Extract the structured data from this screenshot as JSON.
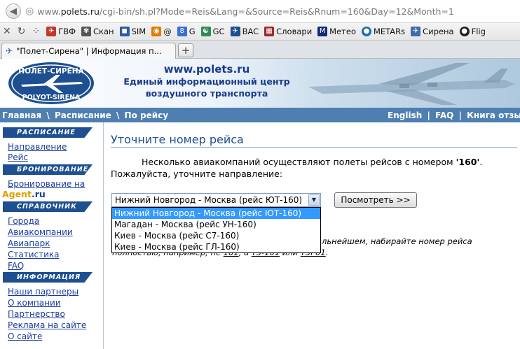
{
  "browser": {
    "url_scheme": "www.",
    "url_host": "polets.ru",
    "url_path": "/cgi-bin/sh.pl?Mode=Reis&Lang=&Source=Reis&Rnum=160&Day=12&Month=1",
    "bookmarks": [
      "ГВФ",
      "Скан",
      "SIM",
      "@",
      "G",
      "GC",
      "BAC",
      "Словари",
      "Метео",
      "METARs",
      "Сирена",
      "Flig"
    ],
    "tab_title": "\"Полет-Сирена\" | Информация п...",
    "new_tab": "+"
  },
  "header": {
    "logo_top": "ПОЛЕТ-СИРЕНА",
    "logo_bottom": "POLYOT-SIRENA",
    "site": "www.polets.ru",
    "line1": "Единый информационный центр",
    "line2": "воздушного транспорта"
  },
  "navbar": {
    "crumb1": "Главная",
    "crumb2": "Расписание",
    "crumb3": "По рейсу",
    "sep": "\\",
    "right1": "English",
    "right2": "FAQ",
    "right3": "Книга отзывов",
    "pipe": "|"
  },
  "sidebar": {
    "schedule_head": "РАСПИСАНИЕ",
    "direction": "Направление",
    "flight": "Рейс",
    "booking_head": "БРОНИРОВАНИЕ",
    "booking_link": "Бронирование на",
    "agent1": "Agent",
    "agent2": ".ru",
    "reference_head": "СПРАВОЧНИК",
    "cities": "Города",
    "airlines": "Авиакомпании",
    "fleet": "Авиапарк",
    "stats": "Статистика",
    "faq": "FAQ",
    "info_head": "ИНФОРМАЦИЯ",
    "partners": "Наши партнеры",
    "about": "О компании",
    "partnership": "Партнерство",
    "ads": "Реклама на сайте",
    "about_site": "О сайте"
  },
  "main": {
    "title": "Уточните номер рейса",
    "msg1_pre": "Несколько авиакомпаний осуществляют полеты рейсов с номером ",
    "msg1_num": "'160'",
    "msg1_post": ".",
    "msg2": "Пожалуйста, уточните направление:",
    "select_value": "Нижний Новгород - Москва (рейс ЮТ-160)",
    "options": [
      "Нижний Новгород - Москва (рейс ЮТ-160)",
      "Магадан - Москва (рейс УН-160)",
      "Киев - Москва (рейс С7-160)",
      "Киев - Москва (рейс ГЛ-160)"
    ],
    "view_button": "Посмотреть >>",
    "hint1": "альнейшем, набирайте номер рейса",
    "hint2_a": "полностью, например, не ",
    "hint2_b": "101",
    "hint2_c": ", а ",
    "hint2_d": "Y3-101",
    "hint2_e": " или ",
    "hint2_f": "Y3P01",
    "hint2_g": "."
  }
}
